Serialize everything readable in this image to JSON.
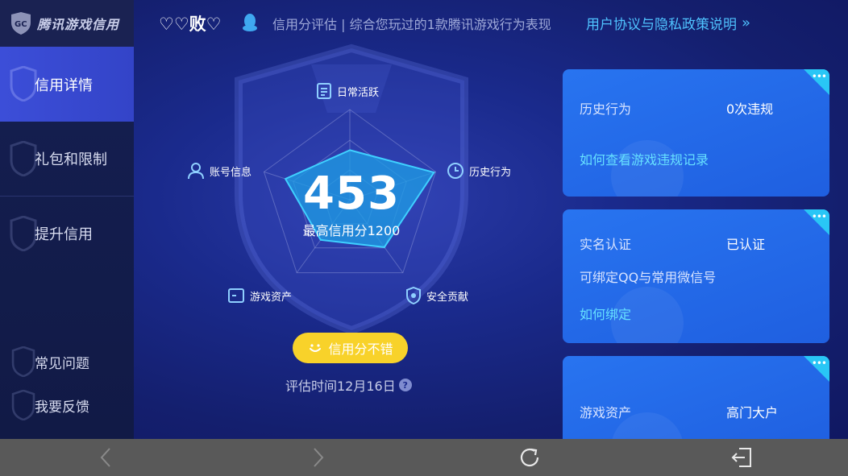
{
  "app": {
    "logo_text": "腾讯游戏信用"
  },
  "sidebar": {
    "items": [
      {
        "label": "信用详情"
      },
      {
        "label": "礼包和限制"
      },
      {
        "label": "提升信用"
      },
      {
        "label": "常见问题"
      },
      {
        "label": "我要反馈"
      }
    ]
  },
  "header": {
    "nickname": "♡♡败♡",
    "subtitle": "信用分评估 | 综合您玩过的1款腾讯游戏行为表现",
    "policy_link": "用户协议与隐私政策说明"
  },
  "radar": {
    "score": "453",
    "max_label": "最高信用分1200",
    "axes": [
      {
        "label": "日常活跃"
      },
      {
        "label": "历史行为"
      },
      {
        "label": "安全贡献"
      },
      {
        "label": "游戏资产"
      },
      {
        "label": "账号信息"
      }
    ],
    "values": [
      0.55,
      0.98,
      0.65,
      0.55,
      0.75
    ],
    "status_button": "信用分不错",
    "eval_time": "评估时间12月16日",
    "help": "?"
  },
  "cards": [
    {
      "key": "历史行为",
      "value": "0次违规",
      "link": "如何查看游戏违规记录"
    },
    {
      "key": "实名认证",
      "value": "已认证",
      "desc": "可绑定QQ与常用微信号",
      "link": "如何绑定"
    },
    {
      "key": "游戏资产",
      "value": "高门大户"
    }
  ],
  "colors": {
    "accent": "#4fc3ff",
    "button": "#f8d22a",
    "card": "#2874f0",
    "radar_fill": "#1e9fe6"
  },
  "bottom_nav": [
    "back-icon",
    "forward-icon",
    "refresh-icon",
    "exit-icon"
  ]
}
